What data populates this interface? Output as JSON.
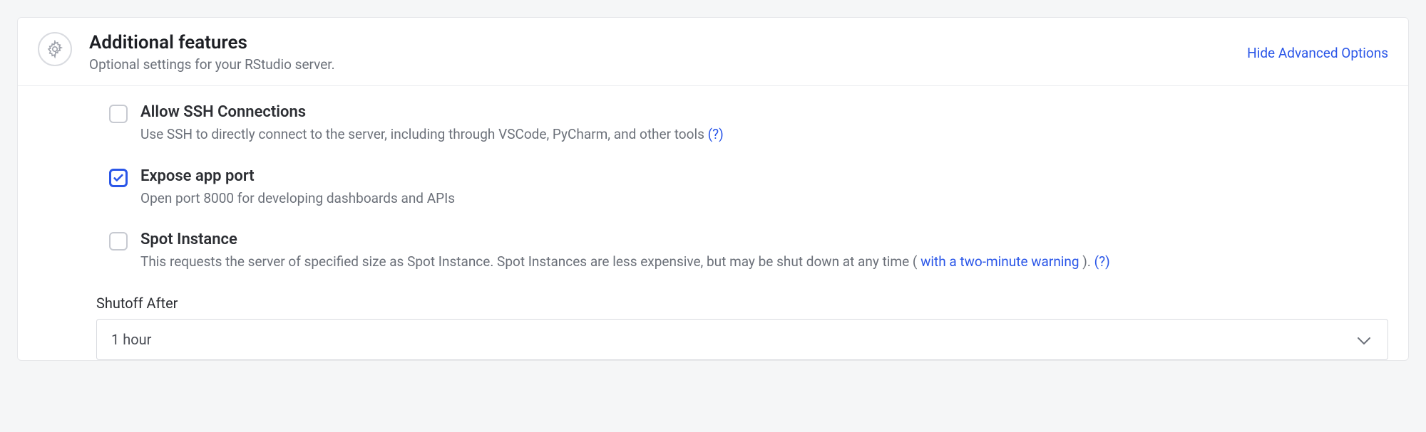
{
  "header": {
    "title": "Additional features",
    "subtitle": "Optional settings for your RStudio server.",
    "action": "Hide Advanced Options"
  },
  "options": {
    "ssh": {
      "title": "Allow SSH Connections",
      "desc": "Use SSH to directly connect to the server, including through VSCode, PyCharm, and other tools ",
      "help": "(?)",
      "checked": false
    },
    "expose": {
      "title": "Expose app port",
      "desc": "Open port 8000 for developing dashboards and APIs",
      "checked": true
    },
    "spot": {
      "title": "Spot Instance",
      "desc_pre": "This requests the server of specified size as Spot Instance. Spot Instances are less expensive, but may be shut down at any time ( ",
      "link": "with a two-minute warning",
      "desc_post": " ). ",
      "help": "(?)",
      "checked": false
    }
  },
  "shutoff": {
    "label": "Shutoff After",
    "value": "1 hour"
  }
}
